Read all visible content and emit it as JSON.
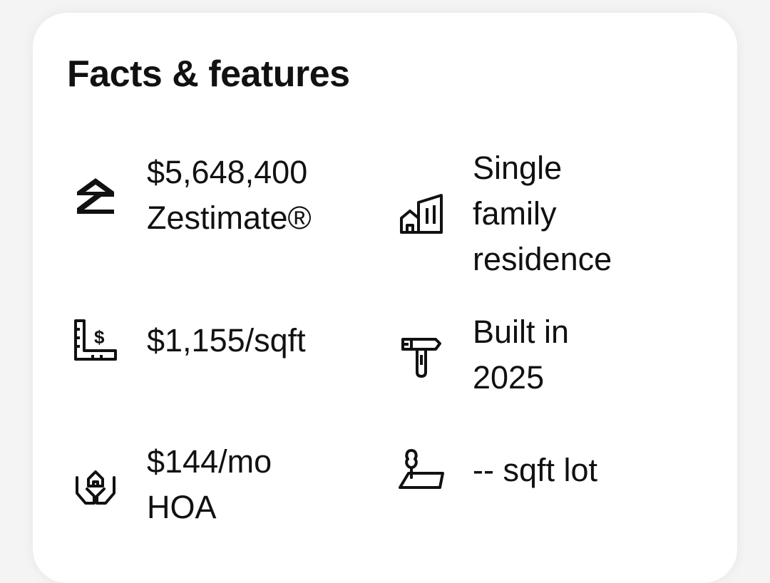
{
  "section": {
    "title": "Facts & features"
  },
  "facts": {
    "zestimate": {
      "icon": "zillow-logo-icon",
      "value": "$5,648,400",
      "label": "Zestimate®"
    },
    "price_per_sqft": {
      "icon": "ruler-dollar-icon",
      "value": "$1,155/sqft"
    },
    "hoa": {
      "icon": "hands-house-icon",
      "value": "$144/mo",
      "label": "HOA"
    },
    "home_type": {
      "icon": "buildings-icon",
      "line1": "Single",
      "line2": "family",
      "line3": "residence"
    },
    "year_built": {
      "icon": "hammer-icon",
      "line1": "Built in",
      "line2": "2025"
    },
    "lot_size": {
      "icon": "lot-tree-icon",
      "value": "-- sqft lot"
    }
  },
  "colors": {
    "text": "#111111",
    "card_background": "#ffffff",
    "page_background": "#f4f4f4"
  }
}
